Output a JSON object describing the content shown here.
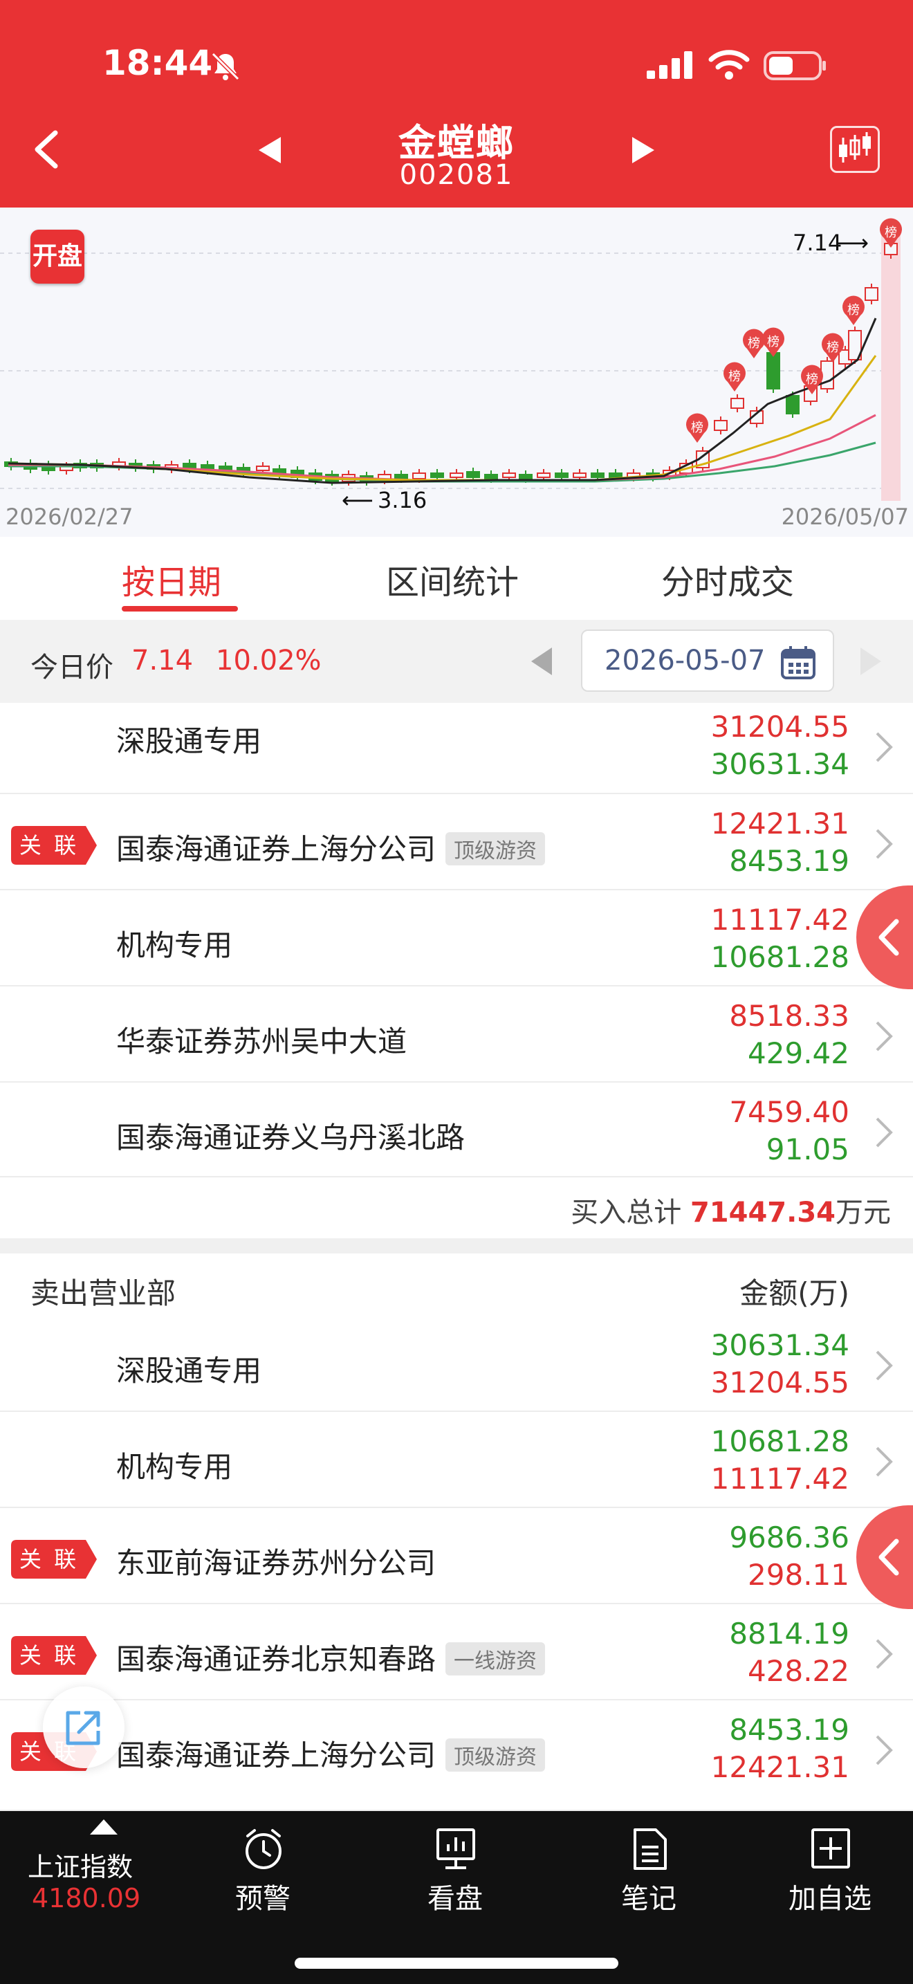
{
  "status_bar": {
    "time": "18:44"
  },
  "header": {
    "stock_name": "金螳螂",
    "stock_code": "002081"
  },
  "chart": {
    "badge": "开盘",
    "start_date": "2026/02/27",
    "end_date": "2026/05/07",
    "high_label": "7.14",
    "low_label": "3.16",
    "rank_marker": "榜"
  },
  "tabs": [
    "按日期",
    "区间统计",
    "分时成交"
  ],
  "info_bar": {
    "label": "今日价",
    "price": "7.14",
    "change_pct": "10.02%",
    "date": "2026-05-07"
  },
  "buy_rows": [
    {
      "name": "深股通专用",
      "tag": "",
      "assoc": false,
      "v1": "31204.55",
      "v2": "30631.34"
    },
    {
      "name": "国泰海通证券上海分公司",
      "tag": "顶级游资",
      "assoc": true,
      "v1": "12421.31",
      "v2": "8453.19"
    },
    {
      "name": "机构专用",
      "tag": "",
      "assoc": false,
      "v1": "11117.42",
      "v2": "10681.28"
    },
    {
      "name": "华泰证券苏州吴中大道",
      "tag": "",
      "assoc": false,
      "v1": "8518.33",
      "v2": "429.42"
    },
    {
      "name": "国泰海通证券义乌丹溪北路",
      "tag": "",
      "assoc": false,
      "v1": "7459.40",
      "v2": "91.05"
    }
  ],
  "buy_total": {
    "label": "买入总计",
    "value": "71447.34",
    "unit": "万元"
  },
  "sell_header": {
    "title": "卖出营业部",
    "amount_label": "金额(万)"
  },
  "sell_rows": [
    {
      "name": "深股通专用",
      "tag": "",
      "assoc": false,
      "v1": "30631.34",
      "v2": "31204.55"
    },
    {
      "name": "机构专用",
      "tag": "",
      "assoc": false,
      "v1": "10681.28",
      "v2": "11117.42"
    },
    {
      "name": "东亚前海证券苏州分公司",
      "tag": "",
      "assoc": true,
      "v1": "9686.36",
      "v2": "298.11"
    },
    {
      "name": "国泰海通证券北京知春路",
      "tag": "一线游资",
      "assoc": true,
      "v1": "8814.19",
      "v2": "428.22"
    },
    {
      "name": "国泰海通证券上海分公司",
      "tag": "顶级游资",
      "assoc": true,
      "v1": "8453.19",
      "v2": "12421.31"
    }
  ],
  "assoc_label": "关 联",
  "bottom_bar": {
    "index_name": "上证指数",
    "index_value": "4180.09",
    "items": [
      "预警",
      "看盘",
      "笔记",
      "加自选"
    ]
  },
  "colors": {
    "brand_red": "#e83234",
    "up": "#e03131",
    "down": "#2e9c2e"
  }
}
